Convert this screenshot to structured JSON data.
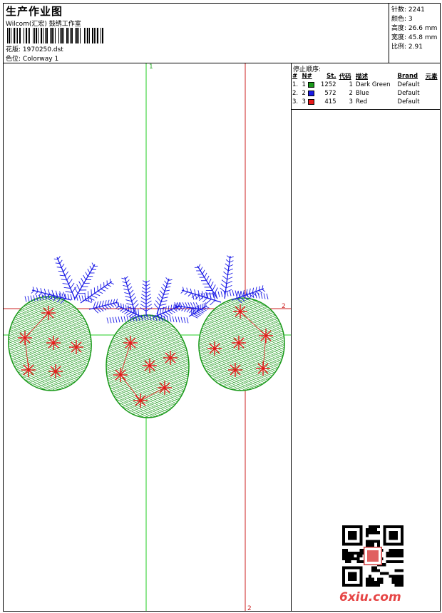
{
  "header": {
    "title": "生产作业图",
    "company": "Wilcom(汇宏) 鼓绣工作室",
    "design_label": "花版:",
    "design_value": "1970250.dst",
    "color_label": "色位:",
    "color_value": "Colorway 1"
  },
  "stats": [
    {
      "label": "针数:",
      "value": "2241"
    },
    {
      "label": "颜色:",
      "value": "3"
    },
    {
      "label": "高度:",
      "value": "26.6 mm"
    },
    {
      "label": "宽度:",
      "value": "45.8 mm"
    },
    {
      "label": "比例:",
      "value": "2.91"
    }
  ],
  "sequence": {
    "title": "停止顺序:",
    "columns": [
      "#",
      "N#",
      "St.",
      "代码",
      "描述",
      "Brand",
      "元素"
    ],
    "rows": [
      {
        "num": "1.",
        "n": "1",
        "color": "#1a9a1a",
        "st": "1252",
        "code": "1",
        "desc": "Dark Green",
        "brand": "Default"
      },
      {
        "num": "2.",
        "n": "2",
        "color": "#1a1ae6",
        "st": "572",
        "code": "2",
        "desc": "Blue",
        "brand": "Default"
      },
      {
        "num": "3.",
        "n": "3",
        "color": "#e61a1a",
        "st": "415",
        "code": "3",
        "desc": "Red",
        "brand": "Default"
      }
    ]
  },
  "markers": {
    "v1": "1",
    "h2": "2",
    "v2": "2"
  },
  "watermark": {
    "logo": "6xiu.com"
  },
  "colors": {
    "green": "#1a9a1a",
    "blue": "#1a1ae6",
    "red": "#e61a1a"
  }
}
